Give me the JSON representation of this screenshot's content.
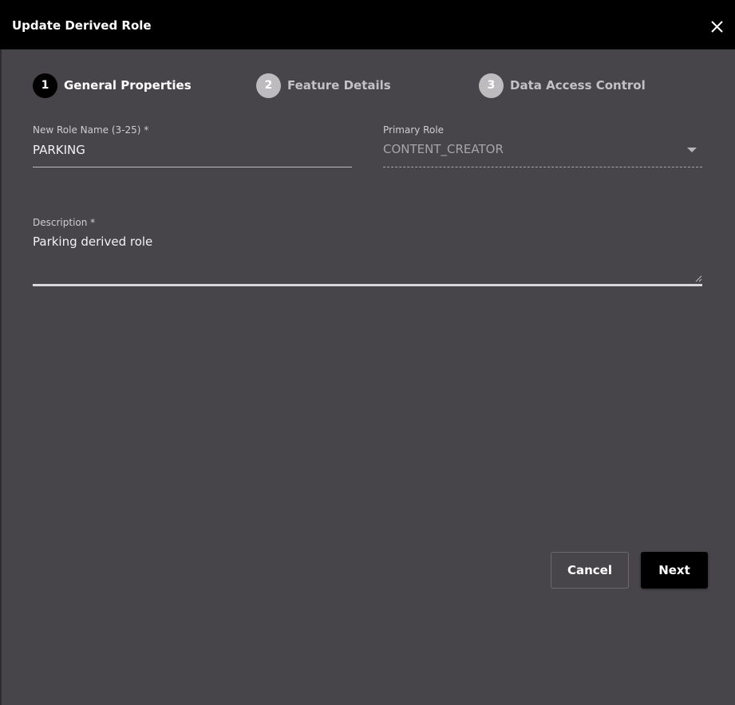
{
  "dialog": {
    "title": "Update Derived Role",
    "close_icon": "close-icon"
  },
  "stepper": {
    "steps": [
      {
        "number": "1",
        "label": "General Properties",
        "state": "active"
      },
      {
        "number": "2",
        "label": "Feature Details",
        "state": "inactive"
      },
      {
        "number": "3",
        "label": "Data Access Control",
        "state": "inactive"
      }
    ]
  },
  "form": {
    "role_name": {
      "label": "New Role Name (3-25) *",
      "value": "PARKING"
    },
    "primary_role": {
      "label": "Primary Role",
      "value": "CONTENT_CREATOR",
      "icon": "chevron-down-icon"
    },
    "description": {
      "label": "Description *",
      "value": "Parking derived role"
    }
  },
  "actions": {
    "cancel_label": "Cancel",
    "next_label": "Next"
  },
  "colors": {
    "header_bg": "#000000",
    "body_bg": "#48454a",
    "primary_button_bg": "#000000",
    "active_step_bg": "#000000",
    "inactive_step_bg": "#bdbbbe"
  }
}
